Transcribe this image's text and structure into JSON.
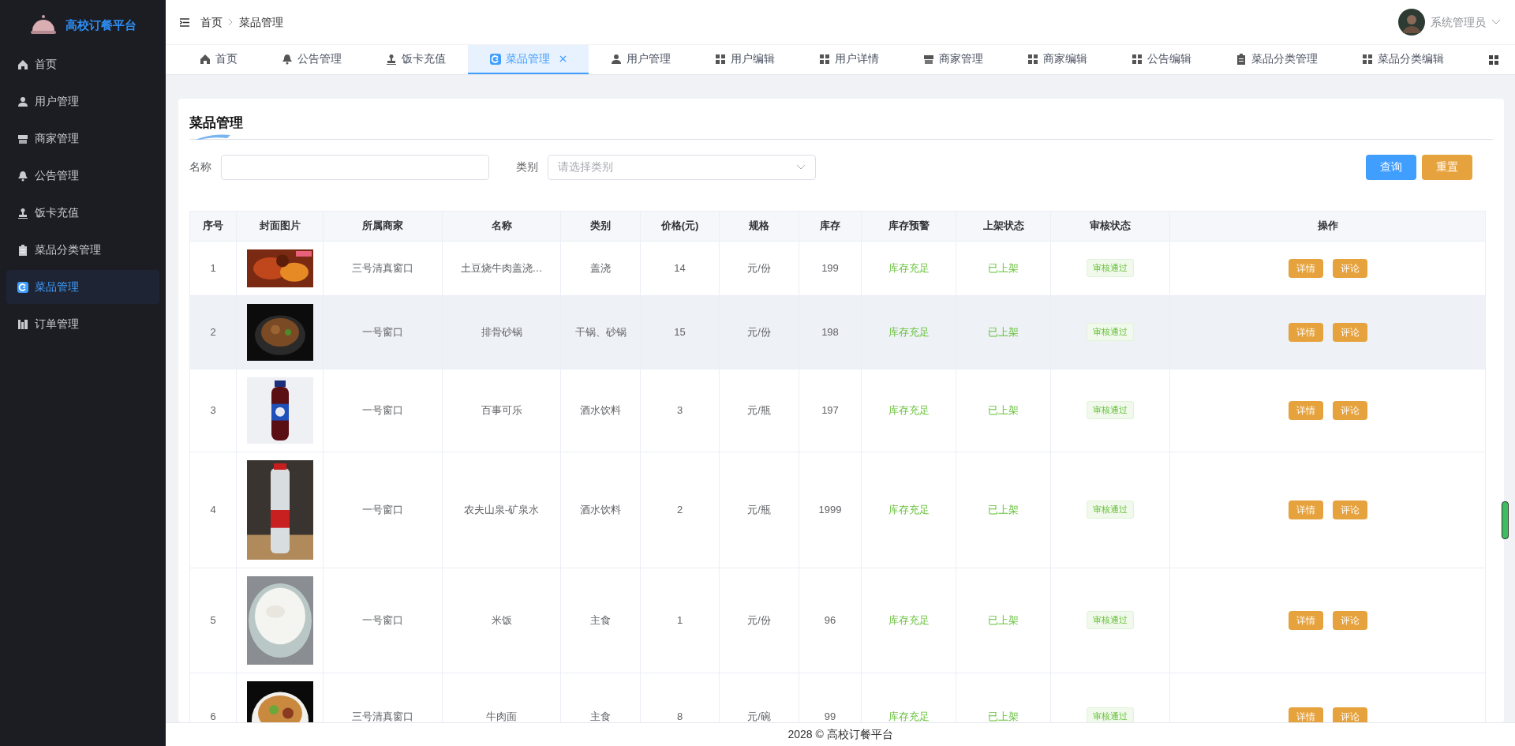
{
  "brand": {
    "title": "高校订餐平台"
  },
  "sidebar": {
    "items": [
      {
        "kind": "home",
        "label": "首页",
        "selected": false
      },
      {
        "kind": "user",
        "label": "用户管理",
        "selected": false
      },
      {
        "kind": "store",
        "label": "商家管理",
        "selected": false
      },
      {
        "kind": "bell",
        "label": "公告管理",
        "selected": false
      },
      {
        "kind": "stamp",
        "label": "饭卡充值",
        "selected": false
      },
      {
        "kind": "clipboard",
        "label": "菜品分类管理",
        "selected": false
      },
      {
        "kind": "dish",
        "label": "菜品管理",
        "selected": true
      },
      {
        "kind": "chart",
        "label": "订单管理",
        "selected": false
      }
    ]
  },
  "breadcrumb": [
    "首页",
    "菜品管理"
  ],
  "user": {
    "name": "系统管理员"
  },
  "tabs": [
    {
      "kind": "home",
      "label": "首页",
      "selected": false
    },
    {
      "kind": "bell",
      "label": "公告管理",
      "selected": false
    },
    {
      "kind": "stamp",
      "label": "饭卡充值",
      "selected": false
    },
    {
      "kind": "dish",
      "label": "菜品管理",
      "selected": true
    },
    {
      "kind": "user",
      "label": "用户管理",
      "selected": false
    },
    {
      "kind": "grid",
      "label": "用户编辑",
      "selected": false
    },
    {
      "kind": "grid",
      "label": "用户详情",
      "selected": false
    },
    {
      "kind": "store",
      "label": "商家管理",
      "selected": false
    },
    {
      "kind": "grid",
      "label": "商家编辑",
      "selected": false
    },
    {
      "kind": "grid",
      "label": "公告编辑",
      "selected": false
    },
    {
      "kind": "clipboard",
      "label": "菜品分类管理",
      "selected": false
    },
    {
      "kind": "grid",
      "label": "菜品分类编辑",
      "selected": false
    }
  ],
  "card": {
    "title": "菜品管理"
  },
  "filters": [
    {
      "label": "名称",
      "kind": "input"
    },
    {
      "label": "类别",
      "kind": "select",
      "placeholder": "请选择类别"
    }
  ],
  "filter_buttons": [
    {
      "label": "查询",
      "kind": "primary"
    },
    {
      "label": "重置",
      "kind": "warning"
    }
  ],
  "table": {
    "columns": [
      "序号",
      "封面图片",
      "所属商家",
      "名称",
      "类别",
      "价格(元)",
      "规格",
      "库存",
      "库存预警",
      "上架状态",
      "审核状态",
      "操作"
    ],
    "rows": [
      {
        "index": "1",
        "merchant": "三号清真窗口",
        "name": "土豆烧牛肉盖浇…",
        "category": "盖浇",
        "price": "14",
        "unit": "元/份",
        "stock": "199",
        "stock_alert": "库存充足",
        "shelf": "已上架",
        "review": "审核通过",
        "actions": [
          "详情",
          "评论"
        ],
        "hovered": false
      },
      {
        "index": "2",
        "merchant": "一号窗口",
        "name": "排骨砂锅",
        "category": "干锅、砂锅",
        "price": "15",
        "unit": "元/份",
        "stock": "198",
        "stock_alert": "库存充足",
        "shelf": "已上架",
        "review": "审核通过",
        "actions": [
          "详情",
          "评论"
        ],
        "hovered": true
      },
      {
        "index": "3",
        "merchant": "一号窗口",
        "name": "百事可乐",
        "category": "酒水饮料",
        "price": "3",
        "unit": "元/瓶",
        "stock": "197",
        "stock_alert": "库存充足",
        "shelf": "已上架",
        "review": "审核通过",
        "actions": [
          "详情",
          "评论"
        ],
        "hovered": false
      },
      {
        "index": "4",
        "merchant": "一号窗口",
        "name": "农夫山泉-矿泉水",
        "category": "酒水饮料",
        "price": "2",
        "unit": "元/瓶",
        "stock": "1999",
        "stock_alert": "库存充足",
        "shelf": "已上架",
        "review": "审核通过",
        "actions": [
          "详情",
          "评论"
        ],
        "hovered": false
      },
      {
        "index": "5",
        "merchant": "一号窗口",
        "name": "米饭",
        "category": "主食",
        "price": "1",
        "unit": "元/份",
        "stock": "96",
        "stock_alert": "库存充足",
        "shelf": "已上架",
        "review": "审核通过",
        "actions": [
          "详情",
          "评论"
        ],
        "hovered": false
      },
      {
        "index": "6",
        "merchant": "三号清真窗口",
        "name": "牛肉面",
        "category": "主食",
        "price": "8",
        "unit": "元/碗",
        "stock": "99",
        "stock_alert": "库存充足",
        "shelf": "已上架",
        "review": "审核通过",
        "actions": [
          "详情",
          "评论"
        ],
        "hovered": false
      }
    ]
  },
  "footer": "2028 © 高校订餐平台"
}
